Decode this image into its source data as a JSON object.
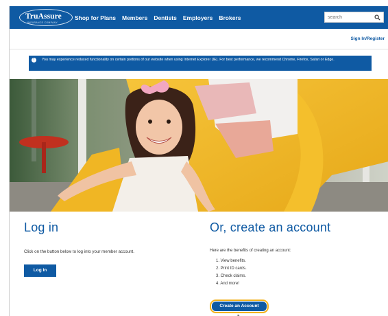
{
  "header": {
    "logo_text": "TruAssure",
    "logo_subtext": "INSURANCE COMPANY",
    "nav": [
      "Shop for Plans",
      "Members",
      "Dentists",
      "Employers",
      "Brokers"
    ],
    "search_placeholder": "search",
    "signin_label": "Sign In/Register"
  },
  "alert": {
    "icon": "info-icon",
    "text": "You may experience reduced functionality on certain portions of our website when using Internet Explorer (IE). For best performance, we recommend Chrome, Firefox, Safari or Edge."
  },
  "hero": {
    "image": "child-on-playground-slide"
  },
  "login": {
    "title": "Log in",
    "description": "Click on the button below to log into your member account.",
    "button_label": "Log In"
  },
  "create": {
    "title": "Or, create an account",
    "description": "Here are the benefits of creating an account:",
    "benefits": [
      "1. View benefits.",
      "2. Print ID cards.",
      "3. Check claims.",
      "4. And more!"
    ],
    "button_label": "Create an Account"
  },
  "colors": {
    "brand_blue": "#0f5aa3",
    "focus_ring": "#f3b21c"
  }
}
